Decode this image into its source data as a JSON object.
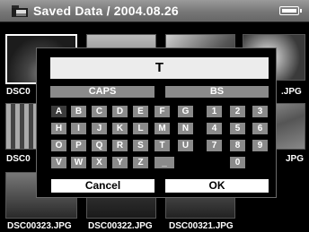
{
  "header": {
    "title": "Saved Data / 2004.08.26"
  },
  "thumbnails": [
    {
      "filename": "DSC0"
    },
    {
      "filename": ".JPG"
    },
    {
      "filename": "DSC0"
    },
    {
      "filename": "JPG"
    },
    {
      "filename": "DSC00323.JPG"
    },
    {
      "filename": "DSC00322.JPG"
    },
    {
      "filename": "DSC00321.JPG"
    }
  ],
  "dialog": {
    "input_value": "T",
    "caps_label": "CAPS",
    "bs_label": "BS",
    "letter_rows": [
      [
        "A",
        "B",
        "C",
        "D",
        "E",
        "F",
        "G"
      ],
      [
        "H",
        "I",
        "J",
        "K",
        "L",
        "M",
        "N"
      ],
      [
        "O",
        "P",
        "Q",
        "R",
        "S",
        "T",
        "U"
      ],
      [
        "V",
        "W",
        "X",
        "Y",
        "Z",
        "_"
      ]
    ],
    "number_rows": [
      [
        "1",
        "2",
        "3"
      ],
      [
        "4",
        "5",
        "6"
      ],
      [
        "7",
        "8",
        "9"
      ],
      [
        "0"
      ]
    ],
    "selected_key": "A",
    "cancel_label": "Cancel",
    "ok_label": "OK"
  }
}
